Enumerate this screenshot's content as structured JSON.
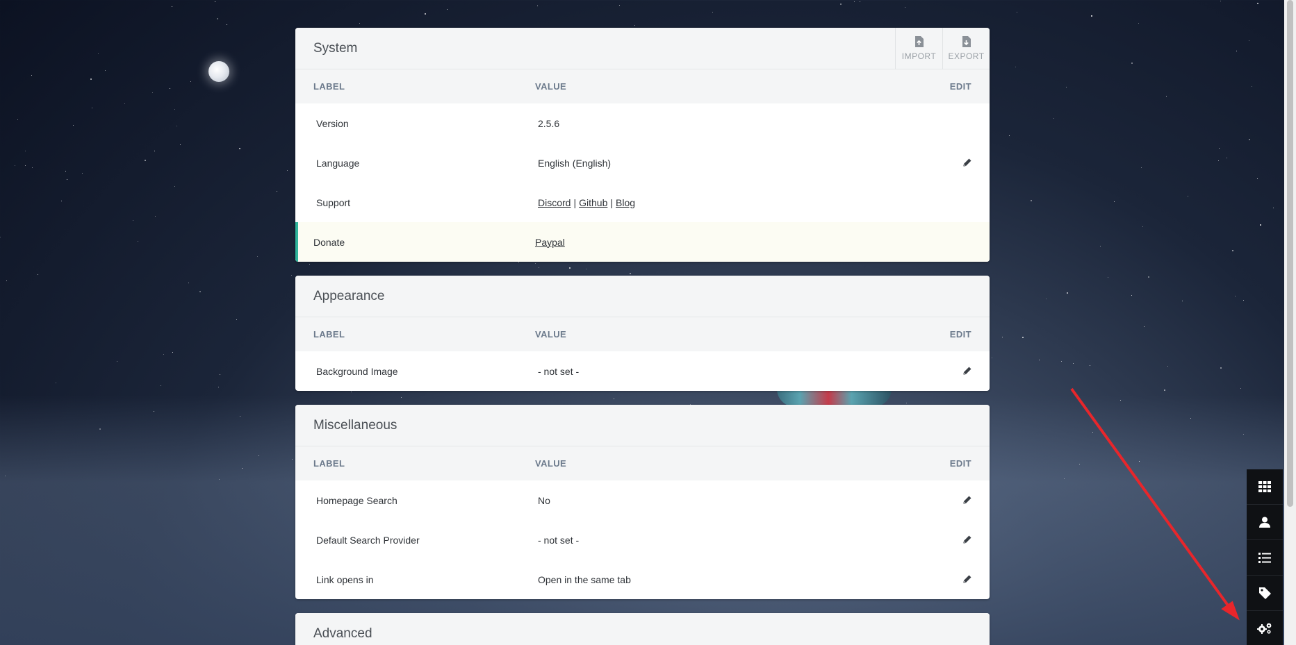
{
  "sections": {
    "system": {
      "title": "System",
      "actions": {
        "import": "IMPORT",
        "export": "EXPORT"
      },
      "headers": {
        "label": "LABEL",
        "value": "VALUE",
        "edit": "EDIT"
      },
      "rows": {
        "version": {
          "label": "Version",
          "value": "2.5.6"
        },
        "language": {
          "label": "Language",
          "value": "English (English)"
        },
        "support": {
          "label": "Support",
          "links": [
            "Discord",
            "Github",
            "Blog"
          ],
          "separator": "|"
        },
        "donate": {
          "label": "Donate",
          "link": "Paypal"
        }
      }
    },
    "appearance": {
      "title": "Appearance",
      "headers": {
        "label": "LABEL",
        "value": "VALUE",
        "edit": "EDIT"
      },
      "rows": {
        "background": {
          "label": "Background Image",
          "value": "- not set -"
        }
      }
    },
    "misc": {
      "title": "Miscellaneous",
      "headers": {
        "label": "LABEL",
        "value": "VALUE",
        "edit": "EDIT"
      },
      "rows": {
        "search": {
          "label": "Homepage Search",
          "value": "No"
        },
        "provider": {
          "label": "Default Search Provider",
          "value": "- not set -"
        },
        "link": {
          "label": "Link opens in",
          "value": "Open in the same tab"
        }
      }
    },
    "advanced": {
      "title": "Advanced"
    }
  },
  "dock": [
    "grid-icon",
    "user-icon",
    "list-icon",
    "tag-icon",
    "cogs-icon"
  ],
  "colors": {
    "accent": "#2fb39a",
    "dock": "#0f1114",
    "arrow": "#e8262b"
  }
}
